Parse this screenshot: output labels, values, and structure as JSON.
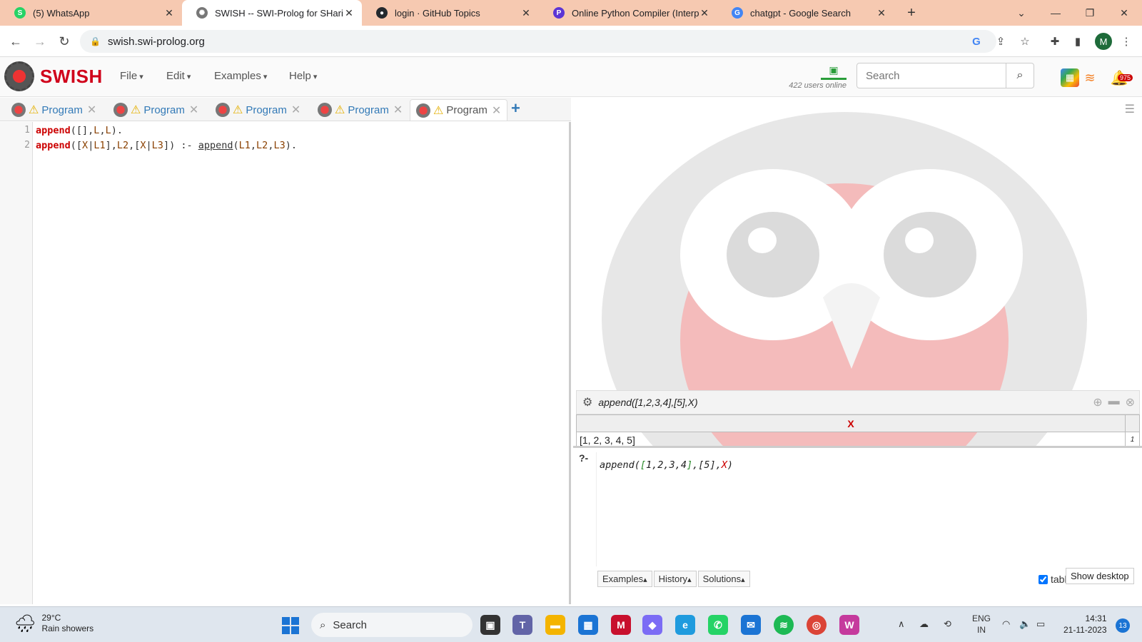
{
  "browser": {
    "tabs": [
      {
        "title": "(5) WhatsApp",
        "favicon": "whatsapp-icon",
        "color": "#25d366"
      },
      {
        "title": "SWISH -- SWI-Prolog for SHarin",
        "favicon": "swish-icon",
        "color": "#666666"
      },
      {
        "title": "login · GitHub Topics",
        "favicon": "github-icon",
        "color": "#24292e"
      },
      {
        "title": "Online Python Compiler (Interpr",
        "favicon": "programiz-icon",
        "color": "#5b35d5"
      },
      {
        "title": "chatgpt - Google Search",
        "favicon": "google-icon",
        "color": "#4285f4"
      }
    ],
    "new_tab": "+",
    "url": "swish.swi-prolog.org",
    "profile_initial": "M"
  },
  "swish": {
    "brand": "SWISH",
    "menus": [
      "File",
      "Edit",
      "Examples",
      "Help"
    ],
    "users_online": "422 users online",
    "search_placeholder": "Search",
    "notification_count": "975"
  },
  "program_tabs": [
    "Program",
    "Program",
    "Program",
    "Program",
    "Program"
  ],
  "editor": {
    "line_numbers": [
      "1",
      "2"
    ]
  },
  "query": {
    "header_text": "append([1,2,3,4],[5],X)",
    "result_column": "X",
    "result_value": "[1, 2, 3, 4, 5]",
    "result_count": "1",
    "prompt": "?-",
    "toolbar": [
      "Examples",
      "History",
      "Solutions"
    ],
    "table_label": "table",
    "tooltip": "Show desktop"
  },
  "taskbar": {
    "temperature": "29°C",
    "weather": "Rain showers",
    "search_label": "Search",
    "lang_1": "ENG",
    "lang_2": "IN",
    "time": "14:31",
    "date": "21-11-2023",
    "notif_count": "13"
  },
  "colors": {
    "accent_blue": "#337ab7",
    "brand_red": "#d0021b",
    "tabstrip": "#f6c9b1"
  }
}
